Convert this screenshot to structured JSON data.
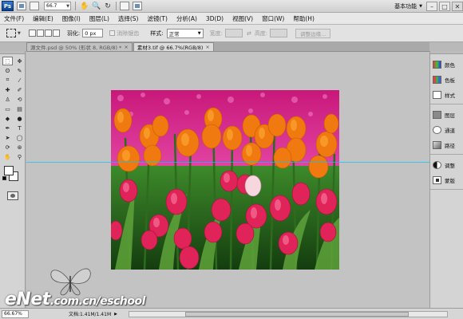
{
  "appbar": {
    "logo": "Ps",
    "zoom": "66.7",
    "workspace": "基本功能",
    "window_min": "–",
    "window_max": "□",
    "window_close": "✕"
  },
  "menu": {
    "items": [
      "文件(F)",
      "编辑(E)",
      "图像(I)",
      "图层(L)",
      "选择(S)",
      "滤镜(T)",
      "分析(A)",
      "3D(D)",
      "视图(V)",
      "窗口(W)",
      "帮助(H)"
    ]
  },
  "options": {
    "feather_label": "羽化:",
    "feather_value": "0 px",
    "antialias_label": "消除锯齿",
    "style_label": "样式:",
    "style_value": "正常",
    "width_label": "宽度:",
    "height_label": "高度:",
    "refine_button": "调整边缘..."
  },
  "tabs": [
    {
      "label": "源文件.psd @ 50% (形状 8, RGB/8) *",
      "close": "×",
      "active": false
    },
    {
      "label": "素材3.tif @ 66.7%(RGB/8)",
      "close": "×",
      "active": true
    }
  ],
  "panels": {
    "group1": [
      "颜色",
      "色板",
      "样式"
    ],
    "group2": [
      "图层",
      "通道",
      "路径"
    ],
    "group3": [
      "调整",
      "蒙版"
    ]
  },
  "status": {
    "zoom": "66.67%",
    "doc": "文档:1.41M/1.41M"
  },
  "watermark": {
    "brand": "eNet",
    "url": ".com.cn/eschool"
  },
  "colors": {
    "guide": "#00c8ff",
    "tulip_orange": "#f07a10",
    "tulip_red": "#e0245a",
    "background_flowers": "#e0359a"
  }
}
